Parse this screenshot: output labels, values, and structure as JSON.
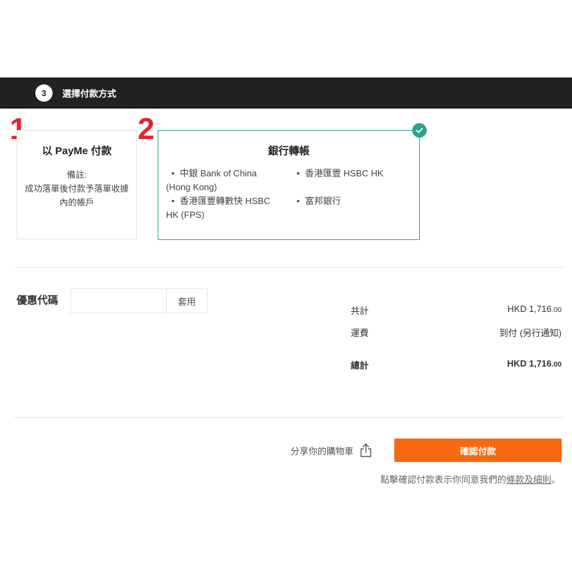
{
  "step": {
    "number": "3",
    "title": "選擇付款方式"
  },
  "annotations": {
    "first": "1",
    "second": "2"
  },
  "payment_options": {
    "payme": {
      "title": "以 PayMe 付款",
      "note_label": "備註:",
      "note_text": "成功落單後付款予落單收據內的帳戶"
    },
    "bank": {
      "title": "銀行轉帳",
      "banks": [
        "中銀 Bank of China (Hong Kong)",
        "香港匯豐 HSBC HK",
        "香港匯豐轉數快 HSBC HK (FPS)",
        "富邦銀行"
      ]
    }
  },
  "promo": {
    "label": "優惠代碼",
    "value": "",
    "apply_label": "套用"
  },
  "summary": {
    "subtotal_label": "共計",
    "subtotal_value": "HKD 1,716",
    "subtotal_cents": ".00",
    "shipping_label": "運費",
    "shipping_value": "到付 (另行通知)",
    "total_label": "總計",
    "total_value": "HKD 1,716",
    "total_cents": ".00"
  },
  "actions": {
    "share_label": "分享你的購物車",
    "confirm_label": "確認付款",
    "terms_prefix": "點擊確認付款表示你同意我們的",
    "terms_link": "條款及細則",
    "terms_suffix": "。"
  },
  "colors": {
    "accent": "#f96a10",
    "selected": "#2aa58d",
    "header_bg": "#222222",
    "annotation": "#e0262f"
  },
  "icons": {
    "share": "share-icon",
    "check": "check-icon"
  }
}
